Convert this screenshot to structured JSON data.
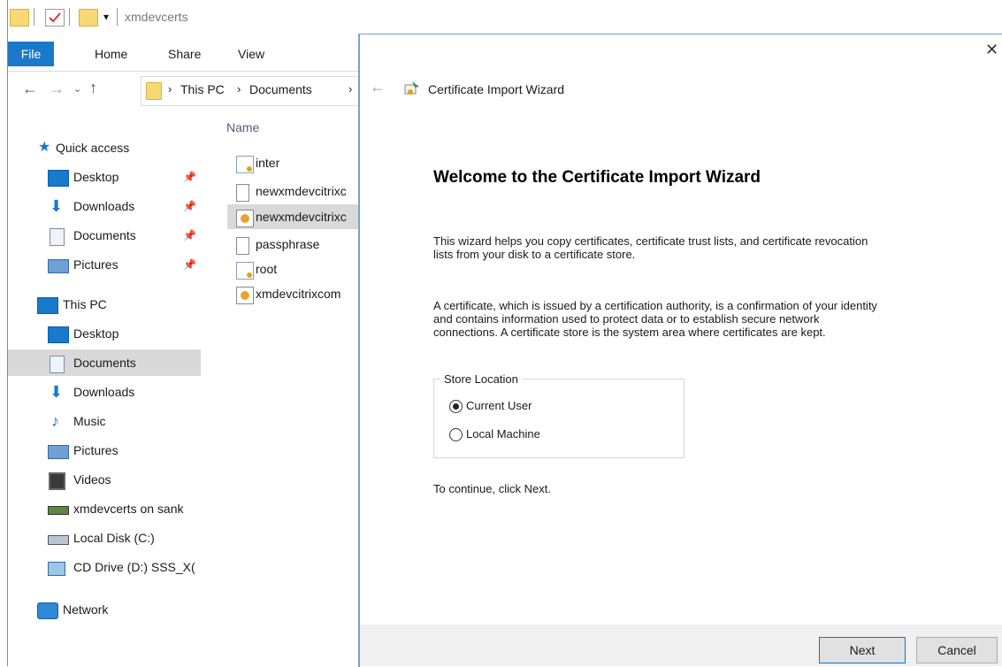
{
  "explorer": {
    "title": "xmdevcerts",
    "tabs": {
      "file": "File",
      "home": "Home",
      "share": "Share",
      "view": "View"
    },
    "breadcrumb": {
      "this_pc": "This PC",
      "documents": "Documents"
    },
    "column_header": "Name",
    "sidebar": {
      "quick_access": "Quick access",
      "qa_items": [
        {
          "label": "Desktop"
        },
        {
          "label": "Downloads"
        },
        {
          "label": "Documents"
        },
        {
          "label": "Pictures"
        }
      ],
      "this_pc": "This PC",
      "pc_items": [
        {
          "label": "Desktop"
        },
        {
          "label": "Documents"
        },
        {
          "label": "Downloads"
        },
        {
          "label": "Music"
        },
        {
          "label": "Pictures"
        },
        {
          "label": "Videos"
        },
        {
          "label": "xmdevcerts on sank"
        },
        {
          "label": "Local Disk (C:)"
        },
        {
          "label": "CD Drive (D:) SSS_X("
        }
      ],
      "network": "Network"
    },
    "files": [
      {
        "name": "inter",
        "icon": "certificate-icon"
      },
      {
        "name": "newxmdevcitrixc",
        "icon": "document-icon"
      },
      {
        "name": "newxmdevcitrixc",
        "icon": "pfx-key-icon"
      },
      {
        "name": "passphrase",
        "icon": "text-file-icon"
      },
      {
        "name": "root",
        "icon": "certificate-icon"
      },
      {
        "name": "xmdevcitrixcom",
        "icon": "pfx-key-icon"
      }
    ]
  },
  "wizard": {
    "title": "Certificate Import Wizard",
    "heading": "Welcome to the Certificate Import Wizard",
    "para1_line1": "This wizard helps you copy certificates, certificate trust lists, and certificate revocation",
    "para1_line2": "lists from your disk to a certificate store.",
    "para2_line1": "A certificate, which is issued by a certification authority, is a confirmation of your identity",
    "para2_line2": "and contains information used to protect data or to establish secure network",
    "para2_line3": "connections. A certificate store is the system area where certificates are kept.",
    "store_location": {
      "label": "Store Location",
      "options": [
        {
          "label": "Current User",
          "selected": true
        },
        {
          "label": "Local Machine",
          "selected": false
        }
      ]
    },
    "continue_text": "To continue, click Next.",
    "next_label": "Next",
    "cancel_label": "Cancel",
    "close_glyph": "✕"
  },
  "colors": {
    "accent": "#1979ca",
    "selection": "#cce8ff",
    "wizard_border": "#7aa0d0"
  }
}
